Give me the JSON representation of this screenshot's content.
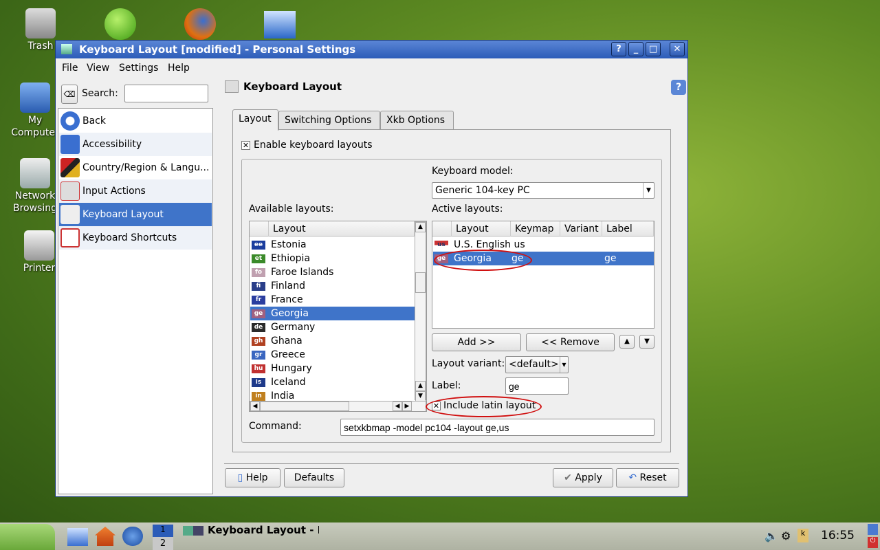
{
  "desktop": {
    "icons": [
      {
        "label": "Trash"
      },
      {
        "label": "My Computer"
      },
      {
        "label": "Network Browsing"
      },
      {
        "label": "Printer"
      }
    ]
  },
  "window": {
    "title": "Keyboard Layout [modified] - Personal Settings",
    "controls": [
      "?",
      "_",
      "□",
      "✕"
    ],
    "menu": [
      "File",
      "View",
      "Settings",
      "Help"
    ],
    "search": {
      "label": "Search:",
      "value": "",
      "placeholder": ""
    },
    "sidebar": [
      {
        "label": "Back",
        "icon": "back-arrow-icon"
      },
      {
        "label": "Accessibility",
        "icon": "accessibility-icon"
      },
      {
        "label": "Country/Region & Langu...",
        "icon": "flags-icon"
      },
      {
        "label": "Input Actions",
        "icon": "keyboard-icon"
      },
      {
        "label": "Keyboard Layout",
        "icon": "keyboard-layout-icon",
        "selected": true
      },
      {
        "label": "Keyboard Shortcuts",
        "icon": "keyboard-shortcuts-icon"
      }
    ],
    "header": "Keyboard Layout",
    "tabs": [
      "Layout",
      "Switching Options",
      "Xkb Options"
    ],
    "enable_label": "Enable keyboard layouts",
    "enable_checked": true,
    "model_label": "Keyboard model:",
    "model_value": "Generic 104-key PC",
    "available_label": "Available layouts:",
    "available_header": "Layout",
    "available": [
      {
        "code": "ee",
        "name": "Estonia",
        "color": "#1a3d9e"
      },
      {
        "code": "et",
        "name": "Ethiopia",
        "color": "#3b8a2a"
      },
      {
        "code": "fo",
        "name": "Faroe Islands",
        "color": "#c0a0b0"
      },
      {
        "code": "fi",
        "name": "Finland",
        "color": "#2a3f8a"
      },
      {
        "code": "fr",
        "name": "France",
        "color": "#2b3ea0"
      },
      {
        "code": "ge",
        "name": "Georgia",
        "color": "#a06080",
        "selected": true
      },
      {
        "code": "de",
        "name": "Germany",
        "color": "#2a2a2a"
      },
      {
        "code": "gh",
        "name": "Ghana",
        "color": "#b04020"
      },
      {
        "code": "gr",
        "name": "Greece",
        "color": "#3a66c0"
      },
      {
        "code": "hu",
        "name": "Hungary",
        "color": "#c03030"
      },
      {
        "code": "is",
        "name": "Iceland",
        "color": "#1e3a8a"
      },
      {
        "code": "in",
        "name": "India",
        "color": "#c08020"
      }
    ],
    "active_label": "Active layouts:",
    "active_headers": [
      "Layout",
      "Keymap",
      "Variant",
      "Label"
    ],
    "active": [
      {
        "code": "us",
        "layout": "U.S. English",
        "keymap": "us",
        "variant": "",
        "label": ""
      },
      {
        "code": "ge",
        "layout": "Georgia",
        "keymap": "ge",
        "variant": "",
        "label": "ge",
        "selected": true
      }
    ],
    "add_label": "Add >>",
    "remove_label": "<< Remove",
    "variant_label": "Layout variant:",
    "variant_value": "<default>",
    "label_label": "Label:",
    "label_value": "ge",
    "latin_label": "Include latin layout",
    "latin_checked": true,
    "command_label": "Command:",
    "command_value": "setxkbmap -model pc104 -layout ge,us",
    "buttons": {
      "help": "Help",
      "defaults": "Defaults",
      "apply": "Apply",
      "reset": "Reset"
    }
  },
  "taskbar": {
    "desktops": [
      "1",
      "2"
    ],
    "task": "Keyboard Layout - P",
    "clock": "16:55"
  },
  "colors": {
    "selection": "#3f74c9",
    "title": "#2c5cb8",
    "annotation": "#d01010"
  }
}
